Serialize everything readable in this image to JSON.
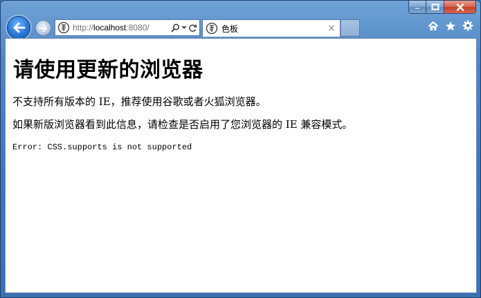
{
  "browser": {
    "address_bar": {
      "url_scheme": "http://",
      "url_host": "localhost",
      "url_rest": ":8080/",
      "refresh_icon": "refresh-icon",
      "search_icon": "search-icon",
      "dropdown_icon": "chevron-down-icon"
    },
    "tab": {
      "title": "色板",
      "close_glyph": "×"
    },
    "toolbar_icons": [
      "home-icon",
      "favorites-star-icon",
      "gear-icon"
    ]
  },
  "page": {
    "title": "请使用更新的浏览器",
    "paragraph_1": "不支持所有版本的 IE，推荐使用谷歌或者火狐浏览器。",
    "paragraph_2": "如果新版浏览器看到此信息，请检查是否启用了您浏览器的 IE 兼容模式。",
    "error": "Error: CSS.supports is not supported"
  },
  "colors": {
    "frame": "#3f76b7",
    "back_button": "#2a78d6",
    "close_button": "#c2412b"
  }
}
